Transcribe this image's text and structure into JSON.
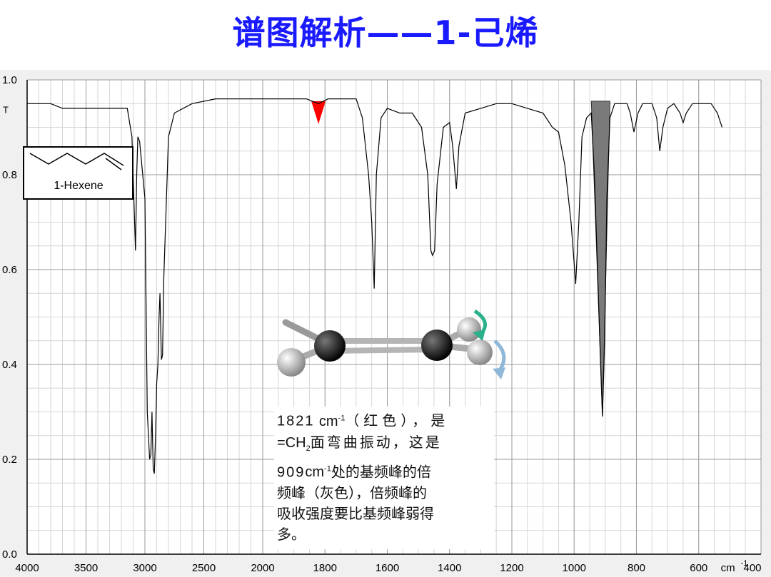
{
  "slide": {
    "title": "谱图解析——1-己烯"
  },
  "legend": {
    "compound_label": "1-Hexene"
  },
  "note": {
    "value1": "1821",
    "unit": "cm",
    "sup": "-1",
    "line1_rest": "（红色），是",
    "line2_prefix": "=CH",
    "line2_sub": "2",
    "line2_rest": "面弯曲振动，这是",
    "value2": "909",
    "line3_rest": "处的基频峰的倍",
    "line4": "频峰（灰色），倍频峰的",
    "line5": "吸收强度要比基频峰弱得",
    "line6": "多。"
  },
  "colors": {
    "title": "#1a1aff",
    "overtone_marker": "#ff0000",
    "fundamental_marker": "#7a7a7a",
    "spectrum_line": "#000000",
    "grid": "#c8c8c8"
  },
  "chart_data": {
    "type": "line",
    "title": "",
    "xlabel": "cm-1",
    "ylabel": "T",
    "xlim": [
      4000,
      400
    ],
    "ylim": [
      0.0,
      1.0
    ],
    "x_ticks": [
      {
        "value": 4000,
        "label": "4000"
      },
      {
        "value": 3500,
        "label": "3500"
      },
      {
        "value": 3000,
        "label": "3000"
      },
      {
        "value": 2500,
        "label": "2500"
      },
      {
        "value": 2000,
        "label": "2000"
      },
      {
        "value": 1800,
        "label": "1800"
      },
      {
        "value": 1600,
        "label": "1600"
      },
      {
        "value": 1400,
        "label": "1400"
      },
      {
        "value": 1200,
        "label": "1200"
      },
      {
        "value": 1000,
        "label": "1000"
      },
      {
        "value": 800,
        "label": "800"
      },
      {
        "value": 600,
        "label": "600"
      },
      {
        "value": 400,
        "label": "400"
      }
    ],
    "y_ticks": [
      {
        "value": 0.0,
        "label": "0.0"
      },
      {
        "value": 0.2,
        "label": "0.2"
      },
      {
        "value": 0.4,
        "label": "0.4"
      },
      {
        "value": 0.6,
        "label": "0.6"
      },
      {
        "value": 0.8,
        "label": "0.8"
      },
      {
        "value": 1.0,
        "label": "1.0"
      }
    ],
    "y_axis_letter": "T",
    "x_unit_label": "cm",
    "x_unit_sup": "-1",
    "grid": true,
    "series": [
      {
        "name": "1-Hexene",
        "points": [
          [
            4000,
            0.95
          ],
          [
            3800,
            0.95
          ],
          [
            3700,
            0.94
          ],
          [
            3400,
            0.94
          ],
          [
            3150,
            0.94
          ],
          [
            3110,
            0.88
          ],
          [
            3080,
            0.64
          ],
          [
            3070,
            0.8
          ],
          [
            3060,
            0.88
          ],
          [
            3045,
            0.87
          ],
          [
            3000,
            0.75
          ],
          [
            2980,
            0.3
          ],
          [
            2960,
            0.2
          ],
          [
            2950,
            0.21
          ],
          [
            2940,
            0.3
          ],
          [
            2930,
            0.18
          ],
          [
            2920,
            0.17
          ],
          [
            2910,
            0.25
          ],
          [
            2900,
            0.36
          ],
          [
            2890,
            0.4
          ],
          [
            2880,
            0.5
          ],
          [
            2872,
            0.55
          ],
          [
            2860,
            0.41
          ],
          [
            2850,
            0.42
          ],
          [
            2840,
            0.58
          ],
          [
            2800,
            0.88
          ],
          [
            2750,
            0.93
          ],
          [
            2600,
            0.95
          ],
          [
            2400,
            0.96
          ],
          [
            2100,
            0.96
          ],
          [
            1950,
            0.96
          ],
          [
            1860,
            0.96
          ],
          [
            1821,
            0.95
          ],
          [
            1790,
            0.96
          ],
          [
            1700,
            0.96
          ],
          [
            1680,
            0.92
          ],
          [
            1660,
            0.8
          ],
          [
            1650,
            0.7
          ],
          [
            1642,
            0.56
          ],
          [
            1635,
            0.8
          ],
          [
            1620,
            0.92
          ],
          [
            1600,
            0.94
          ],
          [
            1560,
            0.93
          ],
          [
            1520,
            0.93
          ],
          [
            1490,
            0.9
          ],
          [
            1470,
            0.8
          ],
          [
            1460,
            0.64
          ],
          [
            1455,
            0.63
          ],
          [
            1448,
            0.64
          ],
          [
            1440,
            0.78
          ],
          [
            1420,
            0.9
          ],
          [
            1400,
            0.91
          ],
          [
            1390,
            0.86
          ],
          [
            1378,
            0.77
          ],
          [
            1370,
            0.86
          ],
          [
            1350,
            0.93
          ],
          [
            1300,
            0.94
          ],
          [
            1250,
            0.95
          ],
          [
            1200,
            0.95
          ],
          [
            1150,
            0.94
          ],
          [
            1100,
            0.93
          ],
          [
            1070,
            0.9
          ],
          [
            1050,
            0.89
          ],
          [
            1030,
            0.82
          ],
          [
            1010,
            0.7
          ],
          [
            995,
            0.57
          ],
          [
            985,
            0.7
          ],
          [
            975,
            0.88
          ],
          [
            960,
            0.92
          ],
          [
            945,
            0.93
          ],
          [
            935,
            0.8
          ],
          [
            925,
            0.6
          ],
          [
            915,
            0.4
          ],
          [
            909,
            0.29
          ],
          [
            902,
            0.45
          ],
          [
            895,
            0.75
          ],
          [
            885,
            0.92
          ],
          [
            870,
            0.95
          ],
          [
            830,
            0.95
          ],
          [
            820,
            0.93
          ],
          [
            808,
            0.89
          ],
          [
            795,
            0.93
          ],
          [
            780,
            0.95
          ],
          [
            750,
            0.95
          ],
          [
            735,
            0.92
          ],
          [
            725,
            0.85
          ],
          [
            715,
            0.9
          ],
          [
            700,
            0.94
          ],
          [
            680,
            0.95
          ],
          [
            660,
            0.93
          ],
          [
            650,
            0.91
          ],
          [
            640,
            0.93
          ],
          [
            620,
            0.95
          ],
          [
            560,
            0.95
          ],
          [
            550,
            0.94
          ],
          [
            540,
            0.93
          ],
          [
            530,
            0.91
          ],
          [
            525,
            0.9
          ]
        ]
      }
    ],
    "annotations": [
      {
        "type": "marker",
        "x": 1821,
        "label": "1821",
        "color": "#ff0000",
        "meaning": "overtone"
      },
      {
        "type": "filled_peak",
        "x": 909,
        "label": "909",
        "color": "#7a7a7a",
        "meaning": "fundamental"
      }
    ],
    "legend_position": "top-left"
  }
}
